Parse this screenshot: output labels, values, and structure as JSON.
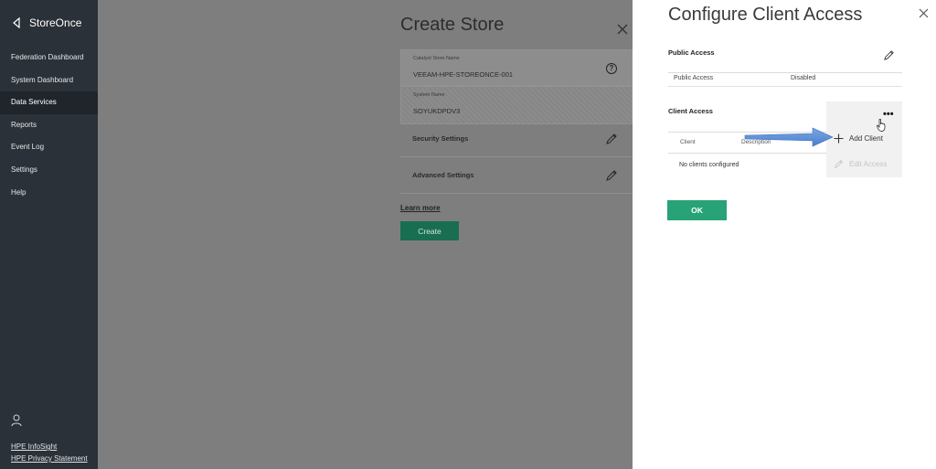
{
  "sidebar": {
    "brand": "StoreOnce",
    "items": [
      {
        "label": "Federation Dashboard"
      },
      {
        "label": "System Dashboard"
      },
      {
        "label": "Data Services"
      },
      {
        "label": "Reports"
      },
      {
        "label": "Event Log"
      },
      {
        "label": "Settings"
      },
      {
        "label": "Help"
      }
    ],
    "active_item": "Data Services",
    "footer_links": [
      "HPE InfoSight",
      "HPE Privacy Statement"
    ]
  },
  "create_store": {
    "title": "Create Store",
    "catalyst_label": "Catalyst Store Name",
    "catalyst_value": "VEEAM-HPE-STOREONCE-001",
    "system_label": "System Name",
    "system_value": "SOYUKDPDV3",
    "security_label": "Security Settings",
    "advanced_label": "Advanced Settings",
    "learn_more": "Learn more",
    "create_button": "Create"
  },
  "configure_client_access": {
    "title": "Configure Client Access",
    "public_access_heading": "Public Access",
    "public_access_label": "Public Access",
    "public_access_value": "Disabled",
    "client_access_heading": "Client Access",
    "columns": [
      "Client",
      "Description"
    ],
    "empty_message": "No clients configured",
    "menu": {
      "dots": "•••",
      "add_client": "Add Client",
      "edit_access": "Edit Access"
    },
    "ok_button": "OK"
  },
  "colors": {
    "sidebar_bg": "#2b3138",
    "overlay_bg": "#7e7e7e",
    "ok_green": "#28a277",
    "arrow_blue": "#5b8fd6"
  }
}
